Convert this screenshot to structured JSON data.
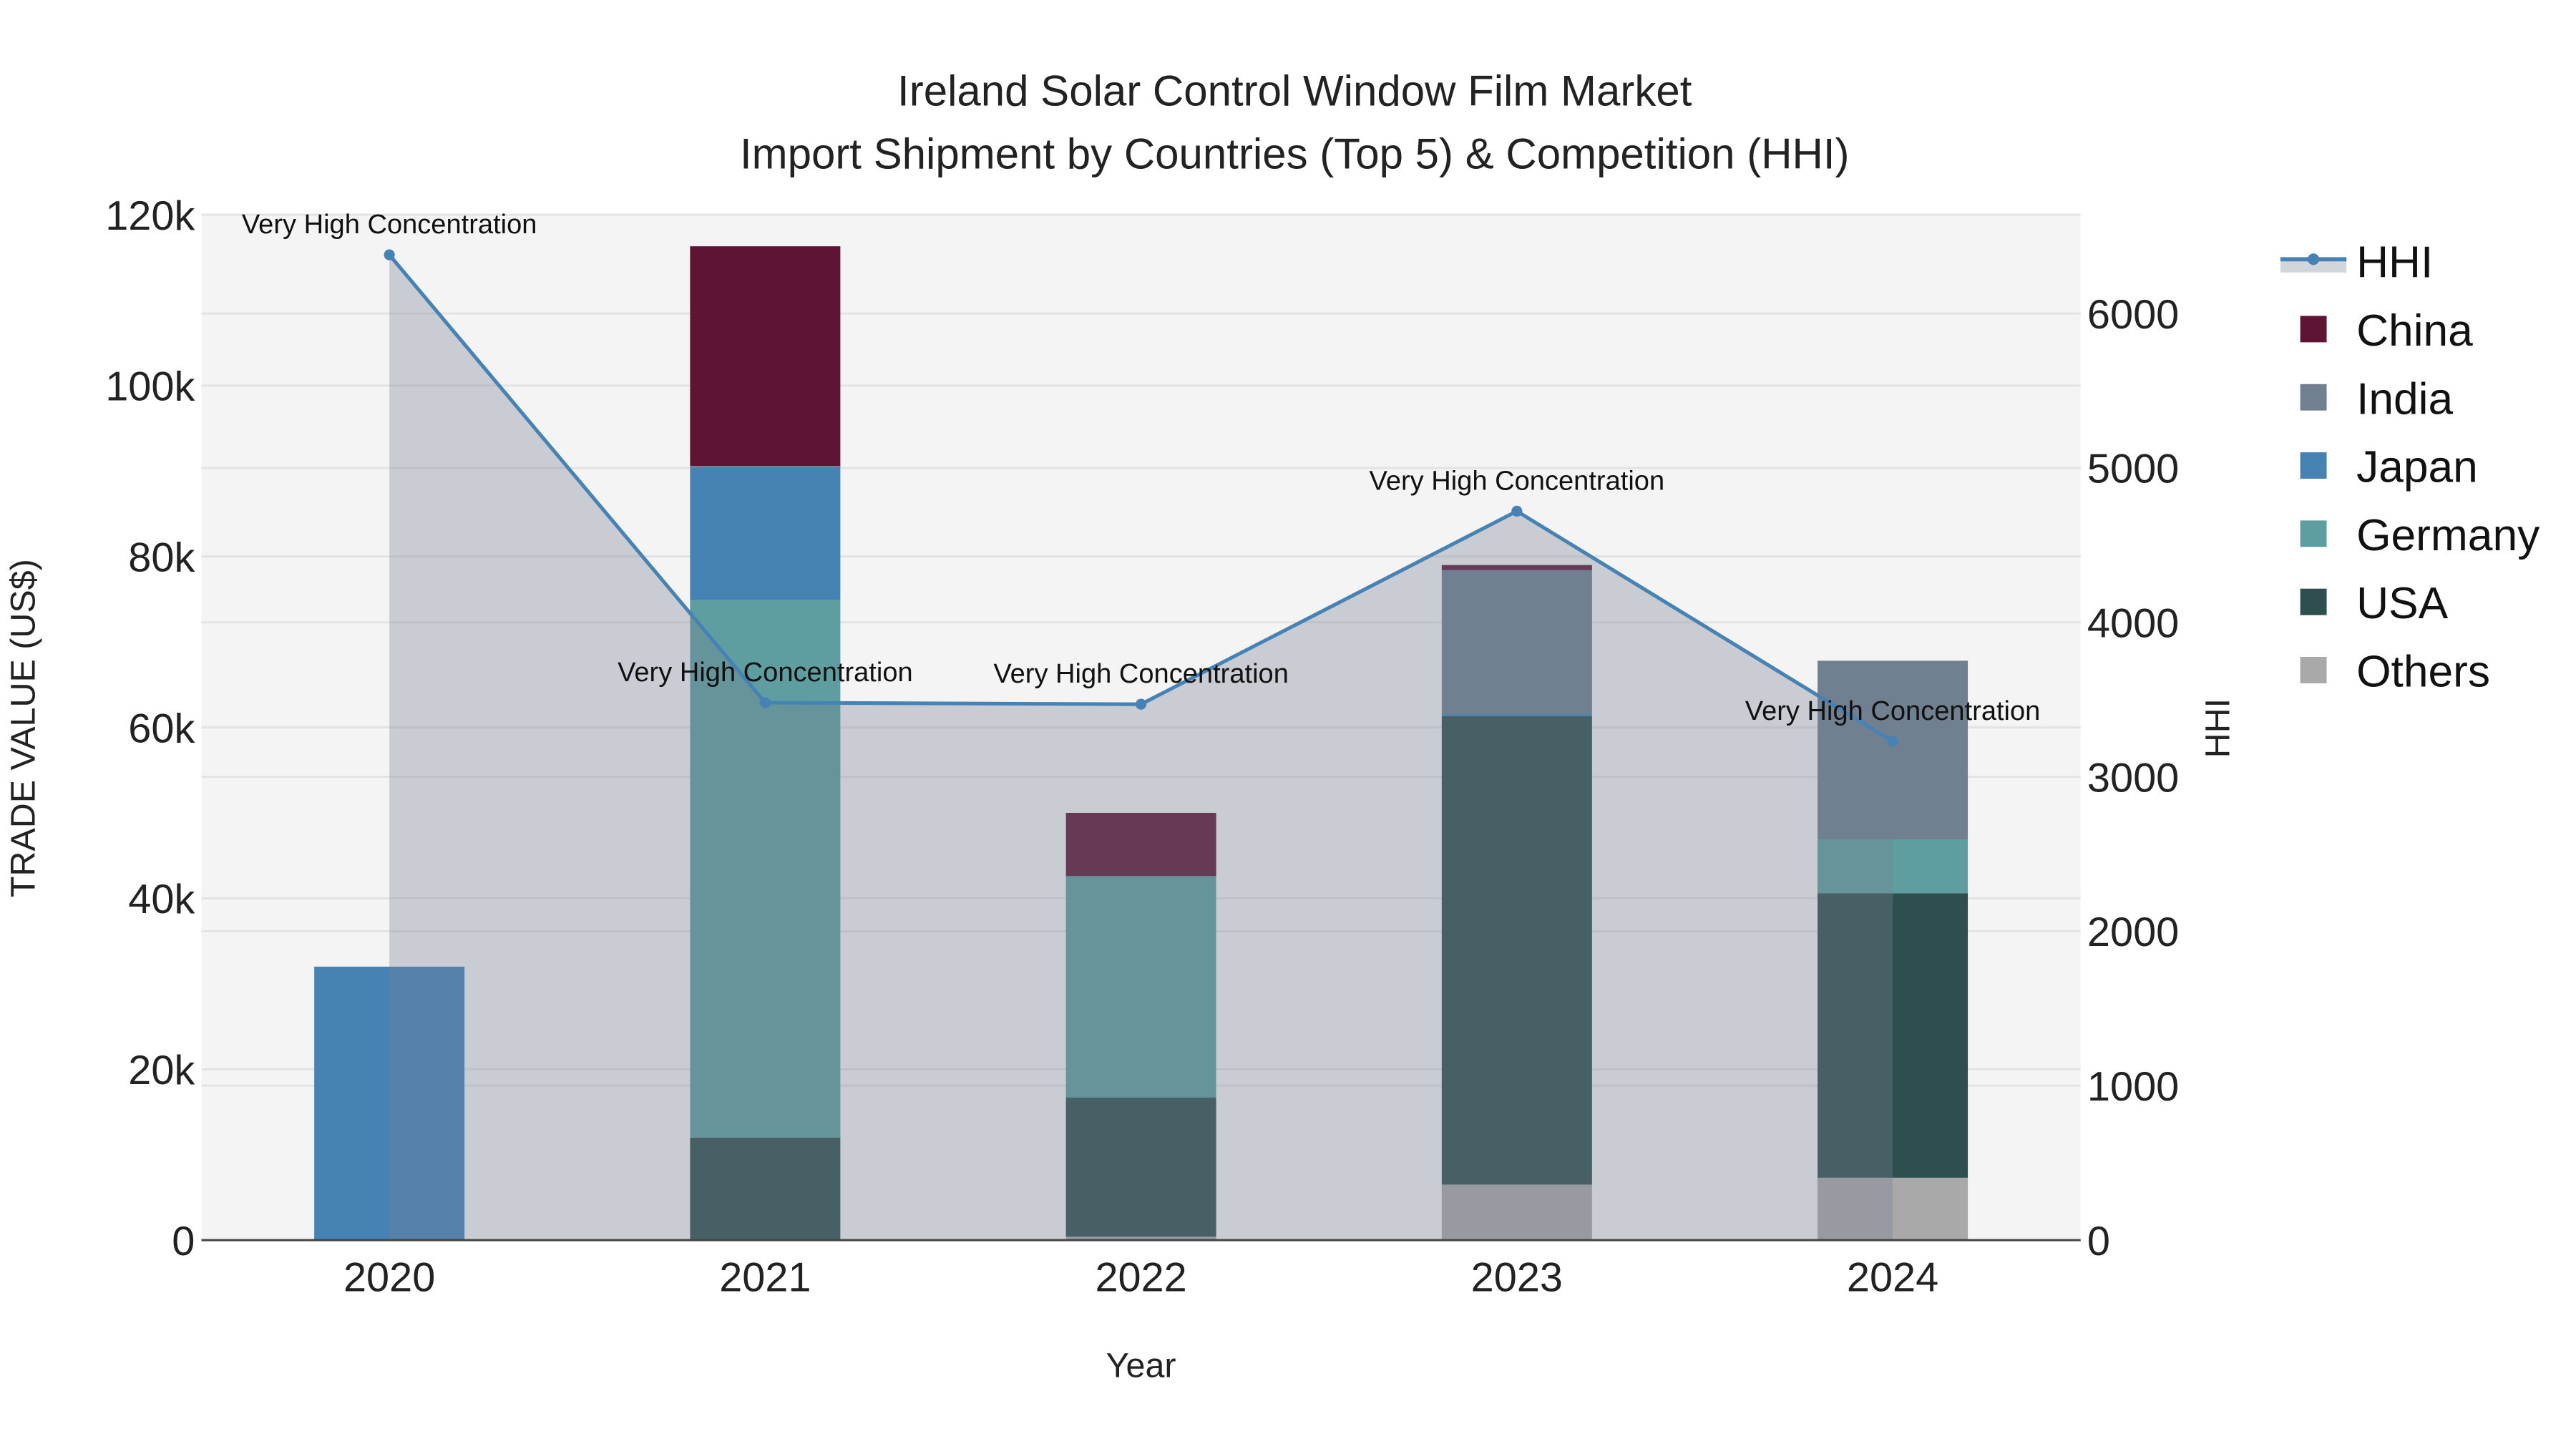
{
  "chart_data": {
    "type": "bar",
    "stacked": true,
    "title": "Ireland Solar Control Window Film Market",
    "subtitle": "Import Shipment by Countries (Top 5) & Competition (HHI)",
    "xlabel": "Year",
    "ylabel": "TRADE VALUE (US$)",
    "y2label": "HHI",
    "categories": [
      "2020",
      "2021",
      "2022",
      "2023",
      "2024"
    ],
    "ylim": [
      0,
      120000
    ],
    "y2lim": [
      0,
      6640
    ],
    "yticks": [
      0,
      20000,
      40000,
      60000,
      80000,
      100000,
      120000
    ],
    "ytick_labels": [
      "0",
      "20k",
      "40k",
      "60k",
      "80k",
      "100k",
      "120k"
    ],
    "y2ticks": [
      0,
      1000,
      2000,
      3000,
      4000,
      5000,
      6000
    ],
    "y2tick_labels": [
      "0",
      "1000",
      "2000",
      "3000",
      "4000",
      "5000",
      "6000"
    ],
    "grid": true,
    "legend_position": "right",
    "series": [
      {
        "name": "Others",
        "color": "#a9a9a9",
        "values": [
          0,
          0,
          400,
          6500,
          7300
        ]
      },
      {
        "name": "USA",
        "color": "#2f4f4f",
        "values": [
          0,
          12000,
          16300,
          54800,
          33300
        ]
      },
      {
        "name": "Germany",
        "color": "#5f9ea0",
        "values": [
          0,
          62900,
          25900,
          0,
          6300
        ]
      },
      {
        "name": "Japan",
        "color": "#4682b4",
        "values": [
          32000,
          15500,
          0,
          300,
          0
        ]
      },
      {
        "name": "India",
        "color": "#708090",
        "values": [
          0,
          200,
          0,
          16800,
          20900
        ]
      },
      {
        "name": "China",
        "color": "#5e1434",
        "values": [
          0,
          25700,
          7400,
          600,
          0
        ]
      }
    ],
    "hhi": {
      "name": "HHI",
      "color": "#4682b4",
      "values": [
        6380,
        3480,
        3470,
        4720,
        3230
      ],
      "annotations": [
        "Very High Concentration",
        "Very High Concentration",
        "Very High Concentration",
        "Very High Concentration",
        "Very High Concentration"
      ]
    },
    "legend_order": [
      "HHI",
      "China",
      "India",
      "Japan",
      "Germany",
      "USA",
      "Others"
    ]
  }
}
